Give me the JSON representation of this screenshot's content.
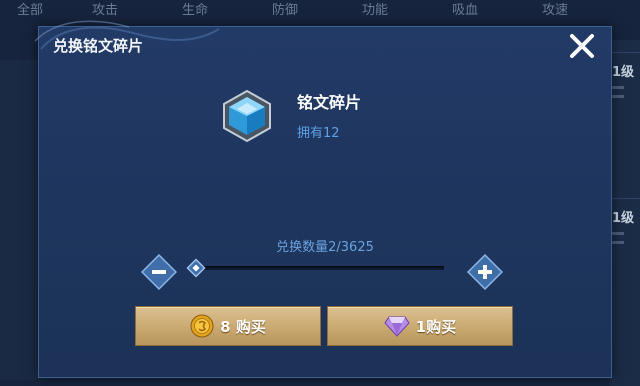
{
  "background": {
    "tabs": [
      "全部",
      "攻击",
      "生命",
      "防御",
      "功能",
      "吸血",
      "攻速",
      "攻速"
    ],
    "side_cards": [
      {
        "level": "1级"
      },
      {
        "level": "1级"
      }
    ]
  },
  "dialog": {
    "title": "兑换铭文碎片",
    "close_icon": "close-icon",
    "item": {
      "name": "铭文碎片",
      "owned": "拥有12",
      "icon": "hexagon-crystal-icon"
    },
    "quantity_label": "兑换数量2/3625",
    "quantity": {
      "current": 2,
      "max": 3625
    },
    "buttons": {
      "gold": {
        "label": "8 购买",
        "icon": "gold-coin-icon"
      },
      "gem": {
        "label": "1购买",
        "icon": "purple-gem-icon"
      }
    }
  }
}
